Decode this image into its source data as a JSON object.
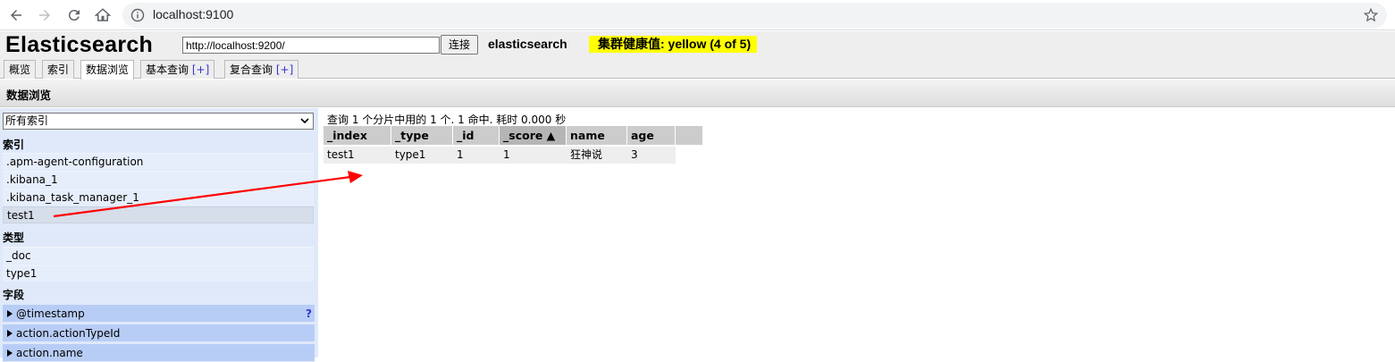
{
  "browser": {
    "url": "localhost:9100",
    "icons": [
      "back-icon",
      "forward-icon",
      "reload-icon",
      "home-icon",
      "info-icon",
      "star-icon"
    ]
  },
  "header": {
    "logo": "Elasticsearch",
    "connect_url": "http://localhost:9200/",
    "connect_label": "连接",
    "cluster_name": "elasticsearch",
    "health": "集群健康值: yellow (4 of 5)",
    "health_color": "#ffff00"
  },
  "tabs": [
    {
      "label": "概览"
    },
    {
      "label": "索引"
    },
    {
      "label": "数据浏览",
      "active": true
    },
    {
      "label": "基本查询",
      "plus": "[+]"
    },
    {
      "label": "复合查询",
      "plus": "[+]"
    }
  ],
  "page_title": "数据浏览",
  "sidebar": {
    "index_select": "所有索引",
    "indices_title": "索引",
    "indices": [
      ".apm-agent-configuration",
      ".kibana_1",
      ".kibana_task_manager_1",
      "test1"
    ],
    "selected_index": "test1",
    "types_title": "类型",
    "types": [
      "_doc",
      "type1"
    ],
    "fields_title": "字段",
    "fields": [
      "@timestamp",
      "action.actionTypeId",
      "action.name"
    ],
    "help": "?"
  },
  "results": {
    "summary": "查询 1 个分片中用的 1 个. 1 命中. 耗时 0.000 秒",
    "columns": [
      "_index",
      "_type",
      "_id",
      "_score ▲",
      "name",
      "age"
    ],
    "rows": [
      [
        "test1",
        "type1",
        "1",
        "1",
        "狂神说",
        "3"
      ]
    ]
  },
  "annotation": {
    "arrow_color": "#ff0000"
  }
}
